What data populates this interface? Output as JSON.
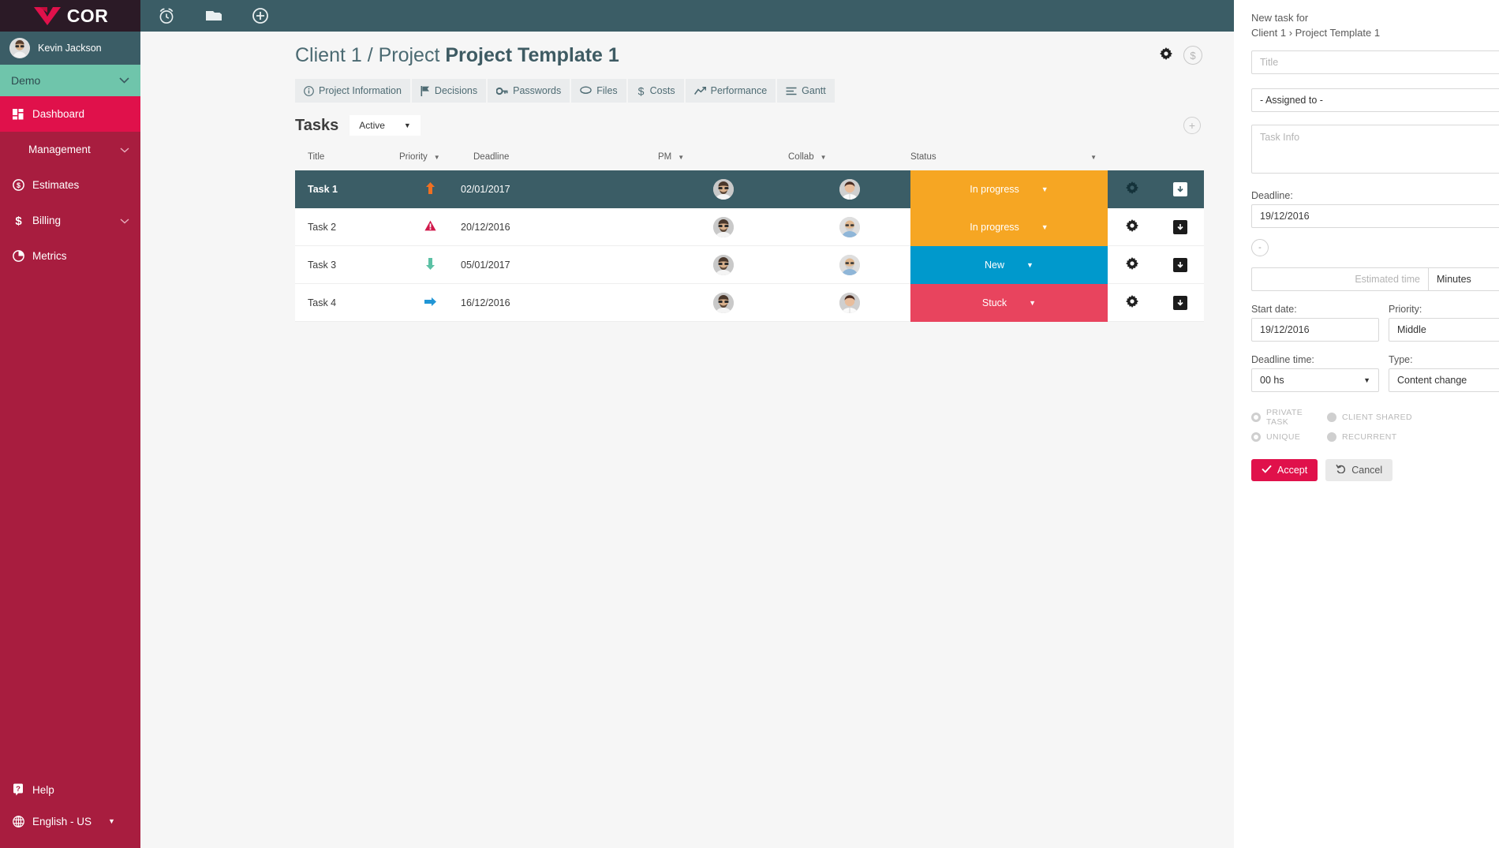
{
  "brand": {
    "name": "COR",
    "logo_icon": "cor-heart-logo"
  },
  "user": {
    "name": "Kevin Jackson",
    "avatar": "user-avatar"
  },
  "workspace": {
    "label": "Demo",
    "caret": "∨"
  },
  "sidebar": {
    "items": [
      {
        "label": "Dashboard",
        "icon": "dashboard-grid-icon",
        "active": true,
        "caret": ""
      },
      {
        "label": "Management",
        "icon": "",
        "active": false,
        "caret": "∨"
      },
      {
        "label": "Estimates",
        "icon": "dollar-circle-icon",
        "active": false,
        "caret": ""
      },
      {
        "label": "Billing",
        "icon": "dollar-icon",
        "active": false,
        "caret": "∨"
      },
      {
        "label": "Metrics",
        "icon": "pie-chart-icon",
        "active": false,
        "caret": ""
      }
    ],
    "bottom": [
      {
        "label": "Help",
        "icon": "help-question-icon"
      },
      {
        "label": "English - US",
        "icon": "globe-icon",
        "caret": "▼"
      }
    ]
  },
  "topbar": {
    "icons": [
      {
        "name": "alarm-clock-icon"
      },
      {
        "name": "folder-icon"
      },
      {
        "name": "add-circle-icon"
      }
    ]
  },
  "header": {
    "breadcrumb_prefix": "Client 1 / Project ",
    "project_name": "Project Template 1",
    "gear_icon": "gear-icon",
    "dollar_icon": "dollar-circle-icon"
  },
  "tabs": [
    {
      "label": "Project Information",
      "icon": "info-circle-icon"
    },
    {
      "label": "Decisions",
      "icon": "flag-icon"
    },
    {
      "label": "Passwords",
      "icon": "key-icon"
    },
    {
      "label": "Files",
      "icon": "files-icon"
    },
    {
      "label": "Costs",
      "icon": "dollar-icon"
    },
    {
      "label": "Performance",
      "icon": "trend-up-icon"
    },
    {
      "label": "Gantt",
      "icon": "gantt-bars-icon"
    }
  ],
  "tasks_section": {
    "title": "Tasks",
    "filter_value": "Active",
    "filter_caret": "▼",
    "add_button_icon": "plus-icon"
  },
  "table": {
    "columns": [
      {
        "key": "title",
        "label": "Title",
        "caret": ""
      },
      {
        "key": "priority",
        "label": "Priority",
        "caret": "▼"
      },
      {
        "key": "deadline",
        "label": "Deadline",
        "caret": ""
      },
      {
        "key": "pm",
        "label": "PM",
        "caret": "▼"
      },
      {
        "key": "collab",
        "label": "Collab",
        "caret": "▼"
      },
      {
        "key": "status",
        "label": "Status",
        "caret": "▼"
      }
    ],
    "rows": [
      {
        "title": "Task 1",
        "priority_icon": "arrow-up-icon",
        "priority_level": "high",
        "deadline": "02/01/2017",
        "pm_avatar": "pm-avatar-1",
        "collab_avatar": "collab-avatar-female",
        "status": "In progress",
        "status_color": "#f6a623",
        "status_caret": "▼",
        "selected": true,
        "gear_icon": "gear-icon",
        "archive_icon": "archive-box-icon"
      },
      {
        "title": "Task 2",
        "priority_icon": "warning-triangle-icon",
        "priority_level": "urgent",
        "deadline": "20/12/2016",
        "pm_avatar": "pm-avatar-1",
        "collab_avatar": "collab-avatar-male",
        "status": "In progress",
        "status_color": "#f6a623",
        "status_caret": "▼",
        "selected": false,
        "gear_icon": "gear-icon",
        "archive_icon": "archive-box-icon"
      },
      {
        "title": "Task 3",
        "priority_icon": "arrow-down-icon",
        "priority_level": "low",
        "deadline": "05/01/2017",
        "pm_avatar": "pm-avatar-1",
        "collab_avatar": "collab-avatar-male",
        "status": "New",
        "status_color": "#0099cc",
        "status_caret": "▼",
        "selected": false,
        "gear_icon": "gear-icon",
        "archive_icon": "archive-box-icon"
      },
      {
        "title": "Task 4",
        "priority_icon": "arrow-right-icon",
        "priority_level": "middle",
        "deadline": "16/12/2016",
        "pm_avatar": "pm-avatar-1",
        "collab_avatar": "collab-avatar-female",
        "status": "Stuck",
        "status_color": "#e8445e",
        "status_caret": "▼",
        "selected": false,
        "gear_icon": "gear-icon",
        "archive_icon": "archive-box-icon"
      }
    ]
  },
  "new_task_panel": {
    "heading_line1": "New task for",
    "heading_line2": "Client 1 › Project Template 1",
    "title_placeholder": "Title",
    "title_value": "",
    "assigned_to": "- Assigned to -",
    "assigned_caret": "▼",
    "task_info_placeholder": "Task Info",
    "task_info_value": "",
    "deadline_label": "Deadline:",
    "deadline_value": "19/12/2016",
    "dash_button": "-",
    "estimated_time_placeholder": "Estimated time",
    "estimated_time_value": "",
    "time_unit": "Minutes",
    "time_unit_caret": "▼",
    "start_date_label": "Start date:",
    "start_date_value": "19/12/2016",
    "priority_label": "Priority:",
    "priority_value": "Middle",
    "priority_caret": "▼",
    "deadline_time_label": "Deadline time:",
    "deadline_time_value": "00 hs",
    "deadline_time_caret": "▼",
    "type_label": "Type:",
    "type_value": "Content change",
    "type_caret": "▼",
    "radios": [
      {
        "label": "PRIVATE TASK",
        "filled": false
      },
      {
        "label": "CLIENT SHARED",
        "filled": true
      },
      {
        "label": "UNIQUE",
        "filled": false
      },
      {
        "label": "RECURRENT",
        "filled": true
      }
    ],
    "accept_label": "Accept",
    "accept_icon": "check-icon",
    "cancel_label": "Cancel",
    "cancel_icon": "undo-icon"
  },
  "colors": {
    "brand_red": "#e0114b",
    "sidebar_red": "#a81d3f",
    "brand_dark": "#2b1a26",
    "teal": "#3b5d66",
    "green": "#6fc5ab",
    "orange": "#f6a623",
    "blue": "#0099cc",
    "pink": "#e8445e"
  }
}
